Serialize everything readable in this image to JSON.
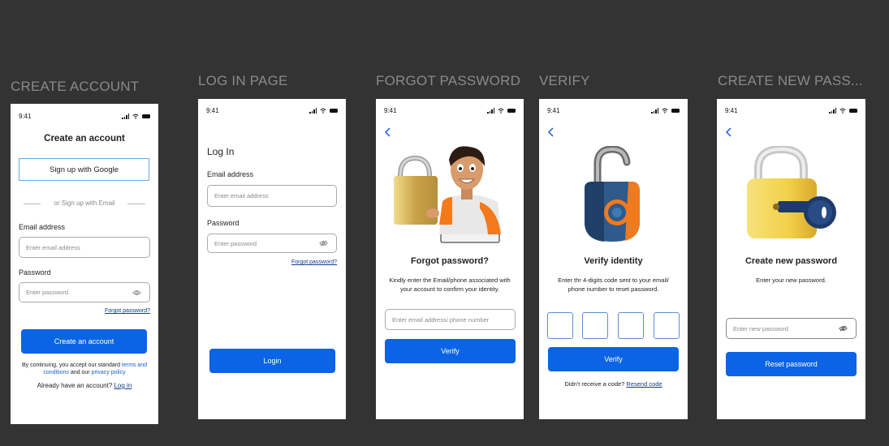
{
  "frames": {
    "create": {
      "title": "CREATE ACCOUNT",
      "time": "9:41",
      "heading": "Create an account",
      "google_button": "Sign up with Google",
      "divider": "or Sign up with Email",
      "email_label": "Email address",
      "email_placeholder": "Enter email address",
      "password_label": "Password",
      "password_placeholder": "Enter password",
      "forgot_link": "Forgot password?",
      "submit_button": "Create an account",
      "terms_prefix": "By continuing, you accept our standard ",
      "terms_link": "terms and conditions",
      "terms_mid": " and our ",
      "privacy_link": "privacy policy",
      "have_account": "Already have an account? ",
      "login_link": "Log in"
    },
    "login": {
      "title": "LOG IN PAGE",
      "time": "9:41",
      "heading": "Log In",
      "email_label": "Email address",
      "email_placeholder": "Enter email address",
      "password_label": "Password",
      "password_placeholder": "Enter password",
      "forgot_link": "Forgot password?",
      "submit_button": "Login"
    },
    "forgot": {
      "title": "FORGOT PASSWORD",
      "time": "9:41",
      "heading": "Forgot password?",
      "description": "Kindly enter the Email/phone associated with your account to confirm your identity.",
      "input_placeholder": "Enter email address/ phone number",
      "submit_button": "Verify"
    },
    "verify": {
      "title": "VERIFY",
      "time": "9:41",
      "heading": "Verify identity",
      "description": "Enter thr 4-digits code sent to your email/ phone number to reset password.",
      "submit_button": "Verify",
      "resend_prefix": "Didn't receive a code? ",
      "resend_link": "Resend code"
    },
    "newpass": {
      "title": "CREATE NEW PASS...",
      "time": "9:41",
      "heading": "Create new password",
      "description": "Enter your new password.",
      "input_placeholder": "Enter new password",
      "submit_button": "Reset password"
    }
  },
  "colors": {
    "canvas": "#333333",
    "primary": "#0b63e5",
    "title_gray": "#8a8a8a"
  }
}
